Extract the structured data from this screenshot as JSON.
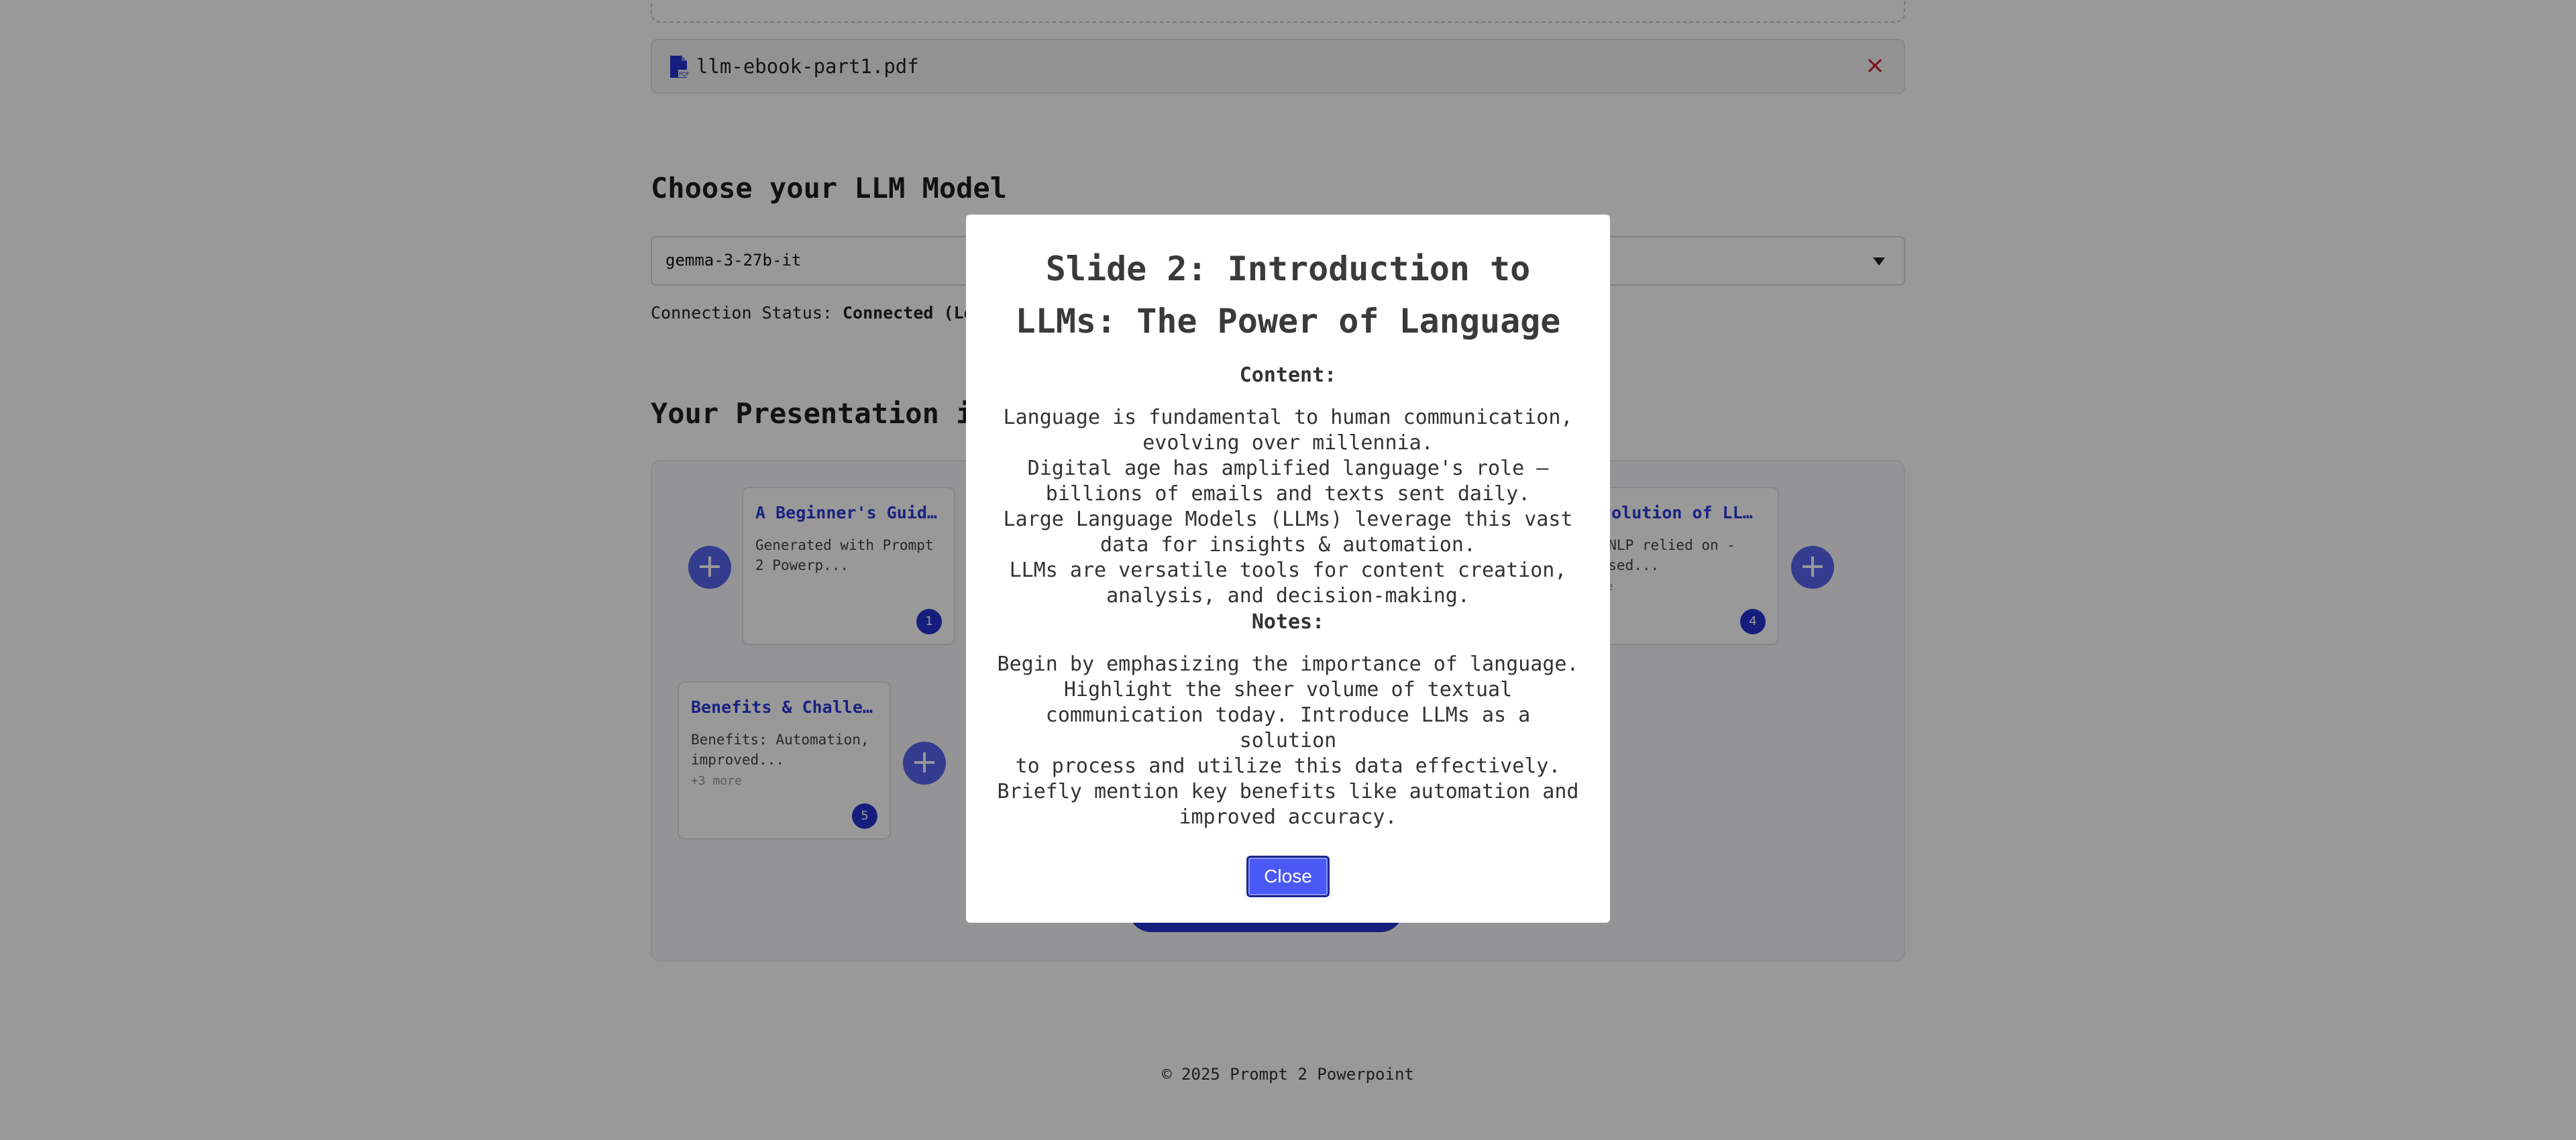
{
  "upload": {
    "file_name": "llm-ebook-part1.pdf",
    "remove_label": "×"
  },
  "model": {
    "heading": "Choose your LLM Model",
    "selected": "gemma-3-27b-it",
    "status_label": "Connection Status:",
    "status_value": "Connected (Loca"
  },
  "presentation": {
    "heading": "Your Presentation is",
    "add_label": "+",
    "cards": [
      {
        "title": "A Beginner's Guide …",
        "desc": "Generated with Prompt 2 Powerp...",
        "more": "",
        "number": "1"
      },
      {
        "title": "Evolution of LL…",
        "desc": "y NLP relied on -based...",
        "more": "ore",
        "number": "4"
      },
      {
        "title": "Benefits & Challeng…",
        "desc": "Benefits: Automation, improved...",
        "more": "+3 more",
        "number": "5"
      }
    ]
  },
  "footer": "© 2025 Prompt 2 Powerpoint",
  "modal": {
    "title": "Slide 2: Introduction to LLMs: The Power of Language",
    "content_label": "Content:",
    "content_lines": [
      "Language is fundamental to human communication,",
      "evolving over millennia.",
      "Digital age has amplified language's role –",
      "billions of emails and texts sent daily.",
      "Large Language Models (LLMs) leverage this vast",
      "data for insights & automation.",
      "LLMs are versatile tools for content creation,",
      "analysis, and decision-making."
    ],
    "notes_label": "Notes:",
    "notes_lines": [
      "Begin by emphasizing the importance of language.",
      "Highlight the sheer volume of textual",
      "communication today. Introduce LLMs as a solution",
      "to process and utilize this data effectively.",
      "Briefly mention key benefits like automation and",
      "improved accuracy."
    ],
    "close_label": "Close"
  },
  "colors": {
    "accent": "#2633d1",
    "button": "#4a58f5",
    "remove": "#d0182b"
  },
  "icons": {
    "file": "pdf-file-icon",
    "dropdown": "chevron-down-icon",
    "add": "plus-icon"
  }
}
